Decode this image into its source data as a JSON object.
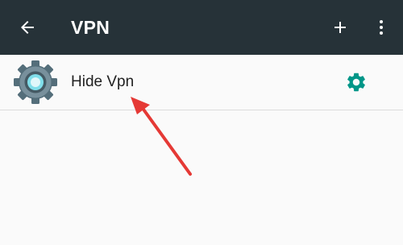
{
  "colors": {
    "toolbar_bg": "#263238",
    "toolbar_fg": "#ffffff",
    "accent": "#009688",
    "annotation": "#e53935",
    "background": "#fafafa"
  },
  "toolbar": {
    "title": "VPN",
    "back_icon": "arrow-back-icon",
    "add_icon": "plus-icon",
    "more_icon": "more-vert-icon"
  },
  "vpn_list": {
    "items": [
      {
        "label": "Hide Vpn",
        "icon": "gear-app-icon",
        "action_icon": "settings-gear-icon"
      }
    ]
  },
  "annotation": {
    "icon": "red-arrow-pointer"
  }
}
